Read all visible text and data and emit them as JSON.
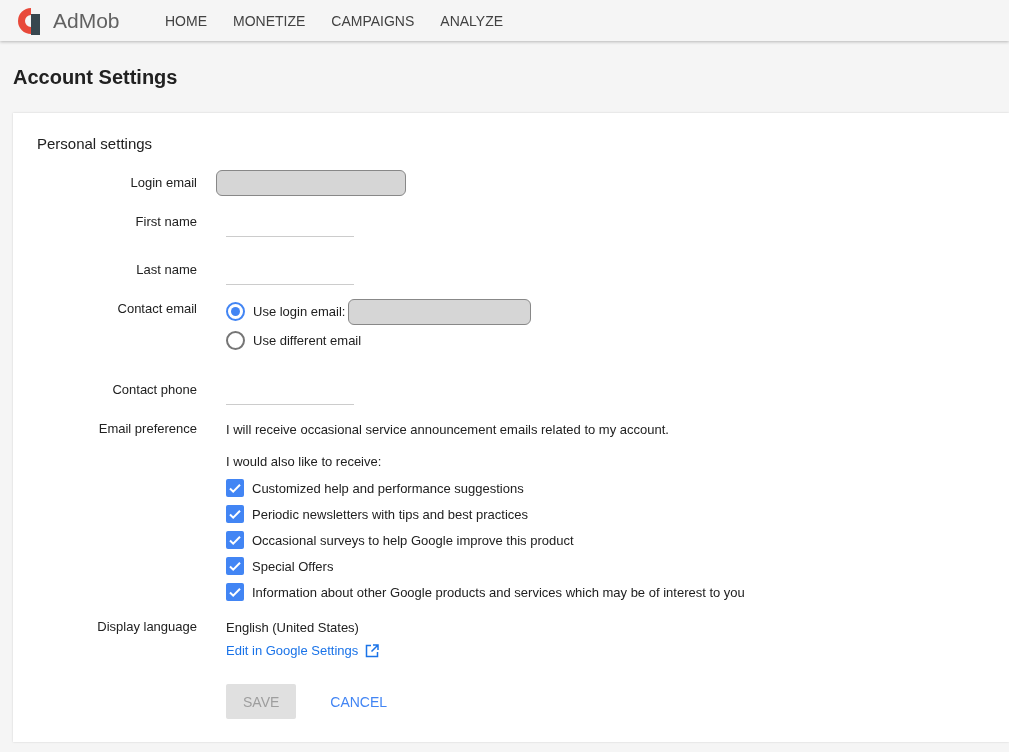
{
  "header": {
    "logo": "AdMob",
    "nav": [
      {
        "label": "HOME"
      },
      {
        "label": "MONETIZE"
      },
      {
        "label": "CAMPAIGNS"
      },
      {
        "label": "ANALYZE"
      }
    ]
  },
  "page_title": "Account Settings",
  "section_title": "Personal settings",
  "fields": [
    {
      "kind": "readonly",
      "label": "Login email"
    },
    {
      "kind": "text",
      "label": "First name"
    },
    {
      "kind": "text",
      "label": "Last name"
    },
    {
      "kind": "radio",
      "label": "Contact email",
      "options": [
        {
          "label": "Use login email:",
          "selected": true,
          "has_box": true
        },
        {
          "label": "Use different email",
          "selected": false,
          "has_box": false
        }
      ]
    },
    {
      "kind": "text",
      "label": "Contact phone"
    },
    {
      "kind": "checks",
      "label": "Email preference",
      "note": "I will receive occasional service announcement emails related to my account.",
      "subnote": "I would also like to receive:",
      "options": [
        {
          "label": "Customized help and performance suggestions",
          "checked": true
        },
        {
          "label": "Periodic newsletters with tips and best practices",
          "checked": true
        },
        {
          "label": "Occasional surveys to help Google improve this product",
          "checked": true
        },
        {
          "label": "Special Offers",
          "checked": true
        },
        {
          "label": "Information about other Google products and services which may be of interest to you",
          "checked": true
        }
      ]
    },
    {
      "kind": "language",
      "label": "Display language",
      "value": "English (United States)",
      "link": "Edit in Google Settings"
    }
  ],
  "actions": [
    {
      "label": "SAVE",
      "disabled": true
    },
    {
      "label": "CANCEL",
      "disabled": false
    }
  ]
}
